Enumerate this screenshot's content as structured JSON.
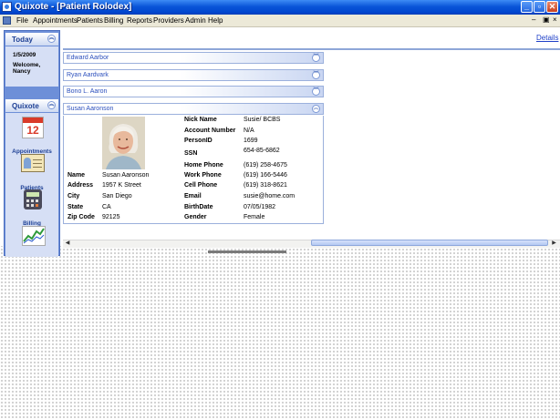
{
  "window": {
    "title": "Quixote - [Patient Rolodex]"
  },
  "menu": [
    "File",
    "Appointments",
    "Patients",
    "Billing",
    "Reports",
    "Providers",
    "Admin",
    "Help"
  ],
  "nav": {
    "today": {
      "header": "Today",
      "date": "1/5/2009",
      "welcome": "Welcome,",
      "user": "Nancy"
    },
    "quixote": {
      "header": "Quixote",
      "items": [
        {
          "label": "Appointments",
          "icon": "calendar-icon",
          "calendar_number": "12"
        },
        {
          "label": "Patients",
          "icon": "patient-card-icon"
        },
        {
          "label": "Billing",
          "icon": "calculator-icon"
        },
        {
          "label": "",
          "icon": "chart-icon"
        }
      ]
    }
  },
  "details_link": "Details",
  "patients": [
    {
      "name": "Edward Aarbor",
      "expanded": false
    },
    {
      "name": "Ryan Aardvark",
      "expanded": false
    },
    {
      "name": "Bono L. Aaron",
      "expanded": false
    },
    {
      "name": "Susan Aaronson",
      "expanded": true
    }
  ],
  "patient_detail": {
    "left": [
      {
        "label": "Name",
        "value": "Susan Aaronson"
      },
      {
        "label": "Address",
        "value": "1957 K Street"
      },
      {
        "label": "City",
        "value": "San Diego"
      },
      {
        "label": "State",
        "value": "CA"
      },
      {
        "label": "Zip Code",
        "value": "92125"
      }
    ],
    "right": [
      {
        "label": "Nick Name",
        "value": "Susie/ BCBS"
      },
      {
        "label": "Account Number",
        "value": "N/A"
      },
      {
        "label": "PersonID",
        "value": "1699"
      },
      {
        "label": "SSN",
        "value": "654-85-6862"
      },
      {
        "label": "Home Phone",
        "value": "(619) 258-4675"
      },
      {
        "label": "Work Phone",
        "value": "(619) 166-5446"
      },
      {
        "label": "Cell Phone",
        "value": "(619) 318-8621"
      },
      {
        "label": "Email",
        "value": "susie@home.com"
      },
      {
        "label": "BirthDate",
        "value": "07/05/1982"
      },
      {
        "label": "Gender",
        "value": "Female"
      }
    ]
  },
  "colors": {
    "titlebar": "#0a55d8",
    "nav": "#6d8fd8",
    "link": "#1f40c8",
    "accordion_text": "#2b4fbd"
  }
}
